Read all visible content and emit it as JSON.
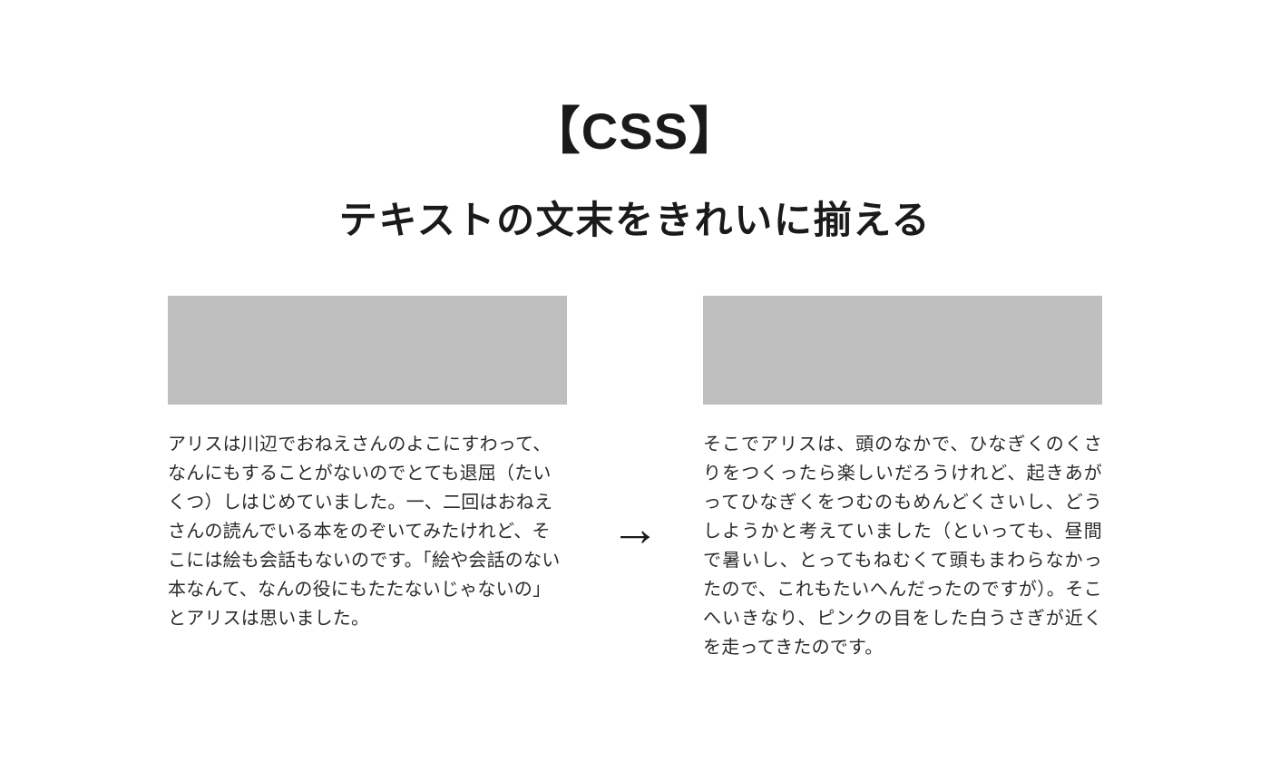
{
  "heading": {
    "title": "【CSS】",
    "subtitle": "テキストの文末をきれいに揃える"
  },
  "arrow": "→",
  "left": {
    "paragraph": "アリスは川辺でおねえさんのよこにすわって、なんにもすることがないのでとても退屈（たいくつ）しはじめていました。一、二回はおねえさんの読んでいる本をのぞいてみたけれど、そこには絵も会話もないのです。「絵や会話のない本なんて、なんの役にもたたないじゃないの」とアリスは思いました。"
  },
  "right": {
    "paragraph": "そこでアリスは、頭のなかで、ひなぎくのくさりをつくったら楽しいだろうけれど、起きあがってひなぎくをつむのもめんどくさいし、どうしようかと考えていました（といっても、昼間で暑いし、とってもねむくて頭もまわらなかったので、これもたいへんだったのですが）。そこへいきなり、ピンクの目をした白うさぎが近くを走ってきたのです。"
  }
}
